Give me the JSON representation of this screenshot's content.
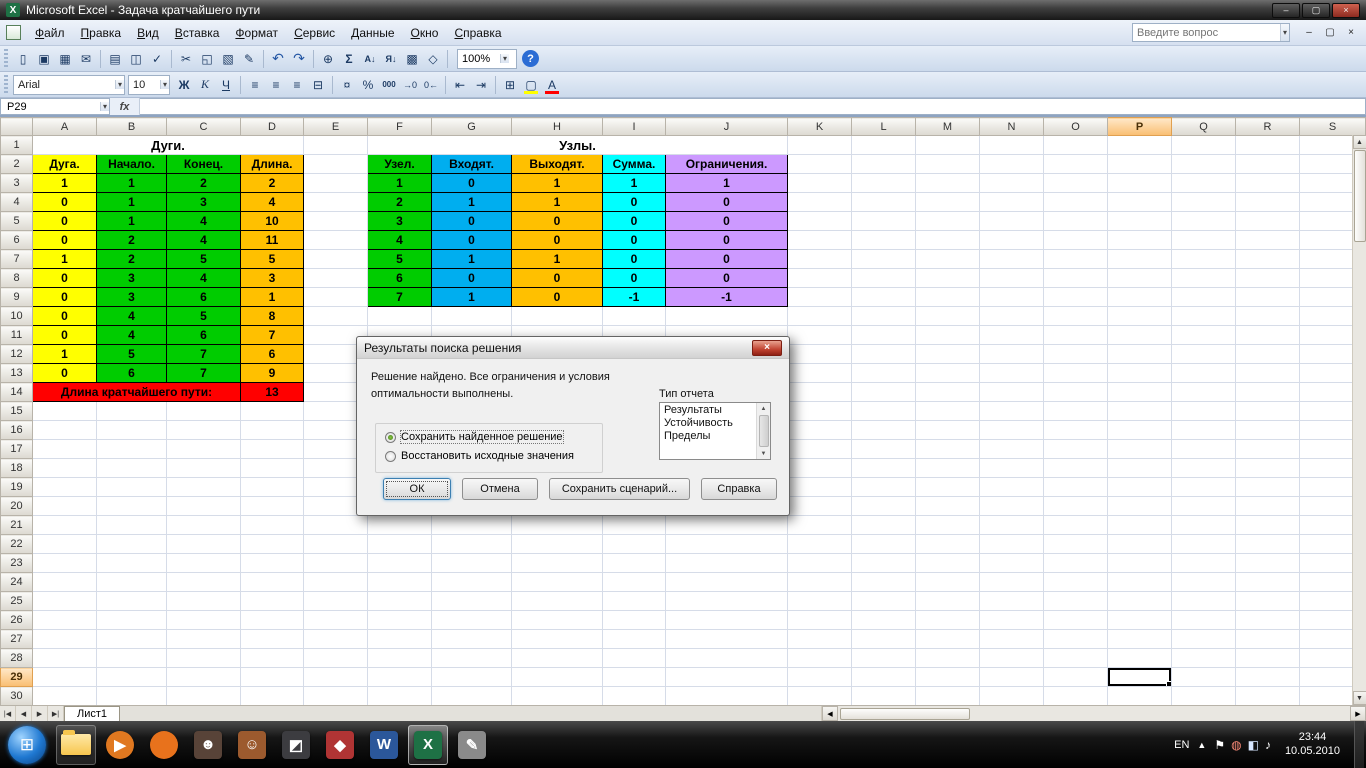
{
  "window": {
    "title": "Microsoft Excel - Задача кратчайшего пути"
  },
  "colors": {
    "yellow": "#FFFF00",
    "green": "#00CC00",
    "blue": "#00AEEF",
    "cyan": "#00FFFF",
    "purple": "#CC99FF",
    "orange": "#FFC000",
    "red": "#FF0000",
    "selection": "#F9BE71"
  },
  "menu": {
    "items": [
      "Файл",
      "Правка",
      "Вид",
      "Вставка",
      "Формат",
      "Сервис",
      "Данные",
      "Окно",
      "Справка"
    ],
    "question_placeholder": "Введите вопрос"
  },
  "standard_toolbar": {
    "zoom_value": "100%",
    "help_glyph": "?",
    "buttons": [
      {
        "name": "new-icon",
        "glyph": "▯"
      },
      {
        "name": "open-icon",
        "glyph": "▣"
      },
      {
        "name": "save-icon",
        "glyph": "▦"
      },
      {
        "name": "email-icon",
        "glyph": "✉"
      },
      {
        "separator": true
      },
      {
        "name": "print-icon",
        "glyph": "▤"
      },
      {
        "name": "print-preview-icon",
        "glyph": "◫"
      },
      {
        "name": "spelling-icon",
        "glyph": "✓"
      },
      {
        "separator": true
      },
      {
        "name": "cut-icon",
        "glyph": "✂"
      },
      {
        "name": "copy-icon",
        "glyph": "◱"
      },
      {
        "name": "paste-icon",
        "glyph": "▧"
      },
      {
        "name": "format-painter-icon",
        "glyph": "✎"
      },
      {
        "separator": true
      },
      {
        "name": "undo-icon",
        "glyph": "↶"
      },
      {
        "name": "redo-icon",
        "glyph": "↷"
      },
      {
        "separator": true
      },
      {
        "name": "hyperlink-icon",
        "glyph": "⊕"
      },
      {
        "name": "autosum-icon",
        "glyph": "Σ"
      },
      {
        "name": "sort-ascending-icon",
        "glyph": "А↓"
      },
      {
        "name": "sort-descending-icon",
        "glyph": "Я↓"
      },
      {
        "name": "chart-wizard-icon",
        "glyph": "▩"
      },
      {
        "name": "drawing-icon",
        "glyph": "◇"
      },
      {
        "separator": true
      }
    ]
  },
  "formatting_toolbar": {
    "font_name": "Arial",
    "font_size": "10",
    "buttons": [
      {
        "name": "bold-icon",
        "glyph": "Ж"
      },
      {
        "name": "italic-icon",
        "glyph": "К"
      },
      {
        "name": "underline-icon",
        "glyph": "Ч"
      },
      {
        "separator": true
      },
      {
        "name": "align-left-icon",
        "glyph": "≡"
      },
      {
        "name": "align-center-icon",
        "glyph": "≡"
      },
      {
        "name": "align-right-icon",
        "glyph": "≡"
      },
      {
        "name": "merge-center-icon",
        "glyph": "⊟"
      },
      {
        "separator": true
      },
      {
        "name": "currency-style-icon",
        "glyph": "¤"
      },
      {
        "name": "percent-style-icon",
        "glyph": "%"
      },
      {
        "name": "comma-style-icon",
        "glyph": "000"
      },
      {
        "name": "increase-decimal-icon",
        "glyph": "→0"
      },
      {
        "name": "decrease-decimal-icon",
        "glyph": "0←"
      },
      {
        "separator": true
      },
      {
        "name": "decrease-indent-icon",
        "glyph": "⇤"
      },
      {
        "name": "increase-indent-icon",
        "glyph": "⇥"
      },
      {
        "separator": true
      },
      {
        "name": "borders-icon",
        "glyph": "⊞"
      },
      {
        "name": "fill-color-icon",
        "glyph": "▢",
        "bar": "#FFFF00"
      },
      {
        "name": "font-color-icon",
        "glyph": "А",
        "bar": "#FF0000"
      }
    ]
  },
  "formula_bar": {
    "name_box": "P29",
    "fx_label": "fx"
  },
  "grid": {
    "columns": [
      "A",
      "B",
      "C",
      "D",
      "E",
      "F",
      "G",
      "H",
      "I",
      "J",
      "K",
      "L",
      "M",
      "N",
      "O",
      "P",
      "Q",
      "R",
      "S"
    ],
    "row_count": 30,
    "selected_cell": "P29",
    "selected_column": "P",
    "selected_row": 29
  },
  "sheet": {
    "arcs_title": "Дуги.",
    "nodes_title": "Узлы.",
    "arcs_headers": [
      "Дуга.",
      "Начало.",
      "Конец.",
      "Длина."
    ],
    "arcs_col_colors": [
      "yellow",
      "green",
      "green",
      "orange"
    ],
    "arcs_rows": [
      [
        1,
        1,
        2,
        2
      ],
      [
        0,
        1,
        3,
        4
      ],
      [
        0,
        1,
        4,
        10
      ],
      [
        0,
        2,
        4,
        11
      ],
      [
        1,
        2,
        5,
        5
      ],
      [
        0,
        3,
        4,
        3
      ],
      [
        0,
        3,
        6,
        1
      ],
      [
        0,
        4,
        5,
        8
      ],
      [
        0,
        4,
        6,
        7
      ],
      [
        1,
        5,
        7,
        6
      ],
      [
        0,
        6,
        7,
        9
      ]
    ],
    "result_label": "Длина кратчайшего пути:",
    "result_value": "13",
    "nodes_headers": [
      "Узел.",
      "Входят.",
      "Выходят.",
      "Сумма.",
      "Ограничения."
    ],
    "nodes_col_colors": [
      "green",
      "blue",
      "orange",
      "cyan",
      "purple"
    ],
    "nodes_rows": [
      [
        1,
        0,
        1,
        1,
        1
      ],
      [
        2,
        1,
        1,
        0,
        0
      ],
      [
        3,
        0,
        0,
        0,
        0
      ],
      [
        4,
        0,
        0,
        0,
        0
      ],
      [
        5,
        1,
        1,
        0,
        0
      ],
      [
        6,
        0,
        0,
        0,
        0
      ],
      [
        7,
        1,
        0,
        -1,
        -1
      ]
    ]
  },
  "sheet_tabs": {
    "nav": [
      "|◀",
      "◀",
      "▶",
      "▶|"
    ],
    "tabs": [
      "Лист1"
    ],
    "active": "Лист1"
  },
  "dialog": {
    "title": "Результаты поиска решения",
    "message_line1": "Решение найдено. Все ограничения и условия",
    "message_line2": "оптимальности выполнены.",
    "radio_keep": "Сохранить найденное решение",
    "radio_restore": "Восстановить исходные значения",
    "report_type_label": "Тип отчета",
    "report_types": [
      "Результаты",
      "Устойчивость",
      "Пределы"
    ],
    "buttons": [
      "ОК",
      "Отмена",
      "Сохранить сценарий...",
      "Справка"
    ]
  },
  "taskbar": {
    "start_glyph": "⊞",
    "language": "EN",
    "time": "23:44",
    "date": "10.05.2010",
    "apps": [
      {
        "name": "windows-explorer",
        "kind": "folder",
        "open": true
      },
      {
        "name": "media-player",
        "glyph": "▶",
        "bg": "#e07820",
        "circle": true
      },
      {
        "name": "firefox",
        "glyph": "",
        "bg": "#e8721c",
        "circle": true
      },
      {
        "name": "game-1",
        "glyph": "☻",
        "bg": "#584338"
      },
      {
        "name": "game-2",
        "glyph": "☺",
        "bg": "#9c5a2e"
      },
      {
        "name": "photo-app",
        "glyph": "◩",
        "bg": "#3c3c40"
      },
      {
        "name": "game-3",
        "glyph": "◆",
        "bg": "#b03434"
      },
      {
        "name": "word",
        "glyph": "W",
        "bg": "#2b579a"
      },
      {
        "name": "excel",
        "glyph": "X",
        "bg": "#1e7145",
        "active": true
      },
      {
        "name": "gimp",
        "glyph": "✎",
        "bg": "#8a8a8a"
      }
    ],
    "tray_icons": [
      {
        "name": "action-center-icon",
        "glyph": "⚑",
        "color": "#ffffff"
      },
      {
        "name": "update-icon",
        "glyph": "◍",
        "color": "#ff8d7a"
      },
      {
        "name": "network-icon",
        "glyph": "◧",
        "color": "#d6e6ff"
      },
      {
        "name": "volume-icon",
        "glyph": "♪",
        "color": "#ffffff"
      }
    ]
  }
}
